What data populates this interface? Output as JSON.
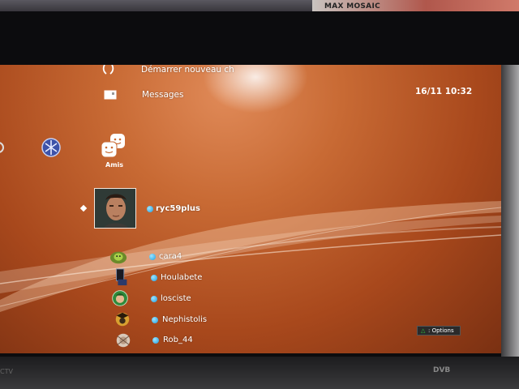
{
  "screen": {
    "clock": "16/11 10:32"
  },
  "menu": {
    "items": [
      {
        "label": "Démarrer nouveau ch",
        "icon": "chat-icon"
      },
      {
        "label": "Messages",
        "icon": "message-icon"
      }
    ]
  },
  "categories": {
    "friends_label": "Amis"
  },
  "friends": {
    "selected": {
      "name": "ryc59plus"
    },
    "list": [
      {
        "name": "cara4"
      },
      {
        "name": "Houlabete"
      },
      {
        "name": "losciste"
      },
      {
        "name": "Nephistolis"
      },
      {
        "name": "Rob_44"
      }
    ]
  },
  "footer": {
    "options_label": ": Options",
    "options_icon": "triangle-button-icon"
  },
  "tv": {
    "brand_right": "DVB",
    "brand_left": "CTV",
    "poster_text": "MAX MOSAIC"
  },
  "colors": {
    "background_orange": "#c86a34",
    "status_online": "#1d9ee0",
    "triangle_green": "#2ec43a"
  }
}
